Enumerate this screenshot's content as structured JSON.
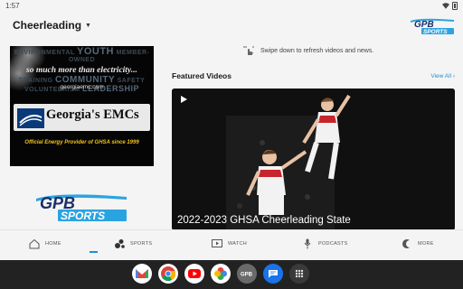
{
  "status_bar": {
    "time": "1:57"
  },
  "header": {
    "sport_title": "Cheerleading"
  },
  "ad": {
    "background_words": [
      "ENVIRONMENTAL",
      "YOUTH",
      "MEMBER-OWNED",
      "TRAINING",
      "COMMUNITY",
      "SAFETY",
      "VOLUNTEERISM",
      "LEADERSHIP"
    ],
    "tagline": "so much more than electricity...",
    "url": "georgiaemc.com",
    "brand": "Georgia's EMCs",
    "subtext": "Official Energy Provider of GHSA since 1999"
  },
  "refresh_hint": "Swipe down to refresh videos and news.",
  "featured": {
    "section_title": "Featured Videos",
    "view_all": "View All ›",
    "video_title": "2022-2023 GHSA Cheerleading State"
  },
  "nav": {
    "items": [
      {
        "label": "HOME",
        "icon": "home-icon"
      },
      {
        "label": "SPORTS",
        "icon": "sports-icon",
        "active": true
      },
      {
        "label": "WATCH",
        "icon": "watch-icon"
      },
      {
        "label": "PODCASTS",
        "icon": "microphone-icon"
      },
      {
        "label": "MORE",
        "icon": "more-icon"
      }
    ]
  },
  "dock": {
    "apps": [
      "Gmail",
      "Chrome",
      "YouTube",
      "Photos",
      "GPB",
      "Messages",
      "Apps"
    ]
  },
  "colors": {
    "accent": "#1d8fd6",
    "taskbar": "#222222",
    "background": "#f4f4f4",
    "ad_yellow": "#f2c316"
  }
}
